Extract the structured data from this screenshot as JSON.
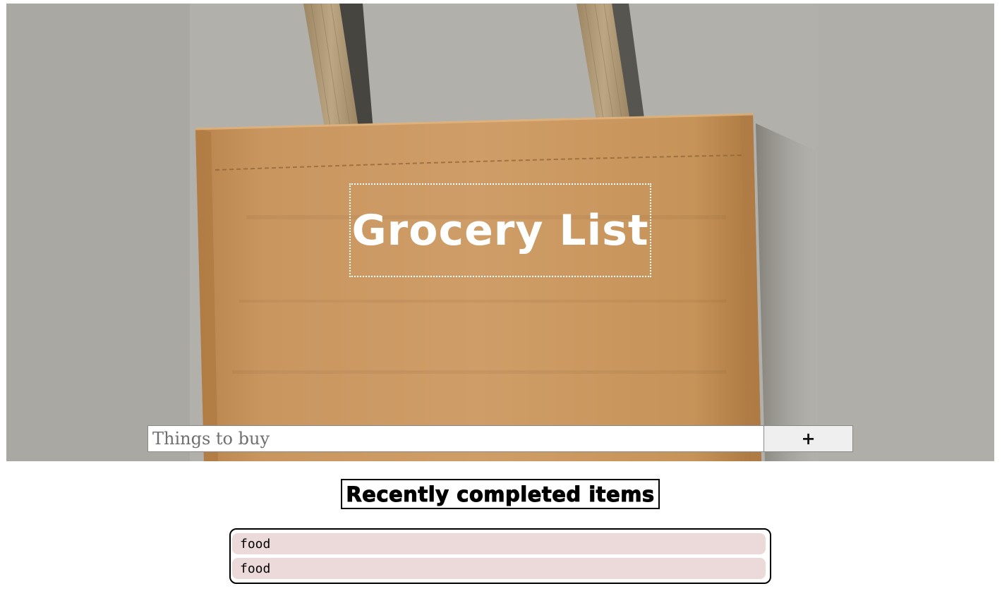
{
  "header": {
    "title": "Grocery List"
  },
  "add_form": {
    "placeholder": "Things to buy",
    "value": "",
    "add_button_label": "+"
  },
  "completed": {
    "heading": "Recently completed items",
    "items": [
      {
        "label": "food"
      },
      {
        "label": "food"
      }
    ]
  },
  "colors": {
    "wall_gray": "#b2b1ab",
    "bag_kraft": "#c9955e",
    "strap_tan": "#b09a78",
    "item_background": "#ecd9d9",
    "title_text": "#ffffff"
  },
  "icons": {
    "hero_image": "kraft-shopping-bag-photo",
    "add_button": "plus-glyph"
  }
}
